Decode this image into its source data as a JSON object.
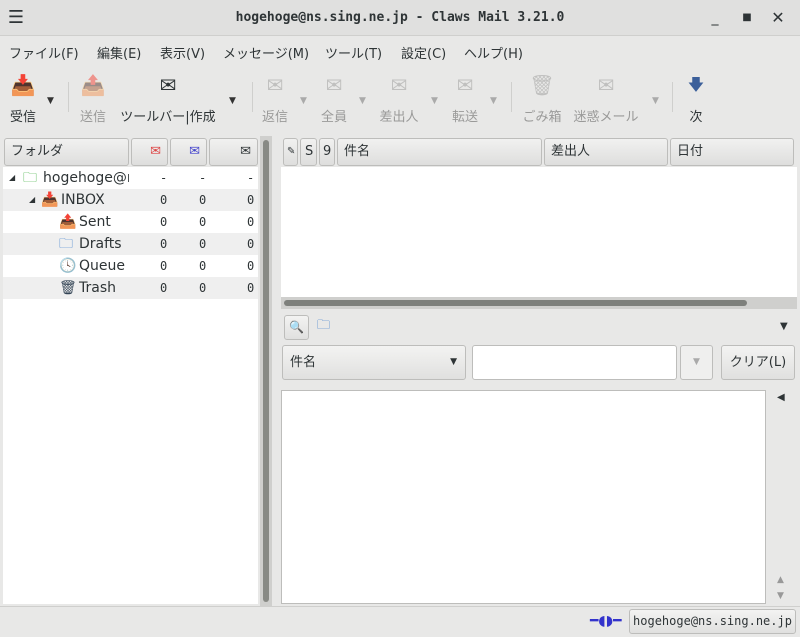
{
  "window": {
    "title": "hogehoge@ns.sing.ne.jp - Claws Mail 3.21.0"
  },
  "menu": [
    "ファイル(F)",
    "編集(E)",
    "表示(V)",
    "メッセージ(M)",
    "ツール(T)",
    "設定(C)",
    "ヘルプ(H)"
  ],
  "toolbar": {
    "receive": "受信",
    "send": "送信",
    "compose": "ツールバー|作成",
    "reply": "返信",
    "reply_all": "全員",
    "reply_sender": "差出人",
    "forward": "転送",
    "trash": "ごみ箱",
    "spam": "迷惑メール",
    "next": "次"
  },
  "folders": {
    "header": "フォルダ",
    "rows": [
      {
        "name": "hogehoge@ns",
        "new": "-",
        "unread": "-",
        "total": "-"
      },
      {
        "name": "INBOX",
        "new": "0",
        "unread": "0",
        "total": "0"
      },
      {
        "name": "Sent",
        "new": "0",
        "unread": "0",
        "total": "0"
      },
      {
        "name": "Drafts",
        "new": "0",
        "unread": "0",
        "total": "0"
      },
      {
        "name": "Queue",
        "new": "0",
        "unread": "0",
        "total": "0"
      },
      {
        "name": "Trash",
        "new": "0",
        "unread": "0",
        "total": "0"
      }
    ]
  },
  "messages": {
    "col_s": "S",
    "col_attach": "9",
    "col_subject": "件名",
    "col_from": "差出人",
    "col_date": "日付"
  },
  "search": {
    "field": "件名",
    "value": "",
    "clear": "クリア(L)"
  },
  "status": {
    "account": "hogehoge@ns.sing.ne.jp"
  }
}
